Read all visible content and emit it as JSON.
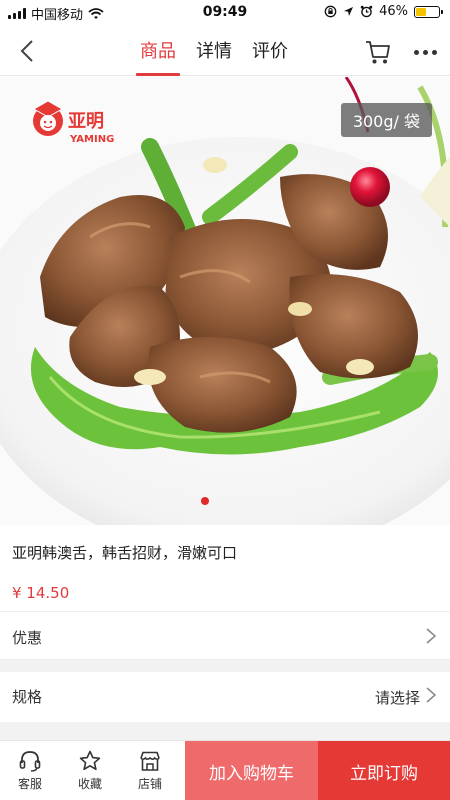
{
  "status_bar": {
    "carrier": "中国移动",
    "time": "09:49",
    "battery": "46%",
    "battery_level": 0.46
  },
  "nav": {
    "tabs": [
      {
        "label": "商品",
        "active": true
      },
      {
        "label": "详情",
        "active": false
      },
      {
        "label": "评价",
        "active": false
      }
    ],
    "accent_color": "#e33b3b"
  },
  "product_image": {
    "weight_badge": "300g/ 袋",
    "brand_cn": "亚明",
    "brand_en": "YAMING",
    "carousel_total": 1,
    "carousel_active": 1
  },
  "product": {
    "title": "亚明韩澳舌，韩舌招财，滑嫩可口",
    "price": "¥ 14.50"
  },
  "promo_row": {
    "label": "优惠"
  },
  "spec_row": {
    "label": "规格",
    "value": "请选择"
  },
  "bottom_bar": {
    "service_label": "客服",
    "favorite_label": "收藏",
    "shop_label": "店铺",
    "add_to_cart": "加入购物车",
    "buy_now": "立即订购"
  },
  "icons": {
    "back": "chevron-left-icon",
    "cart": "cart-icon",
    "more": "more-dots-icon",
    "service": "headset-icon",
    "favorite": "star-icon",
    "shop": "store-icon"
  }
}
